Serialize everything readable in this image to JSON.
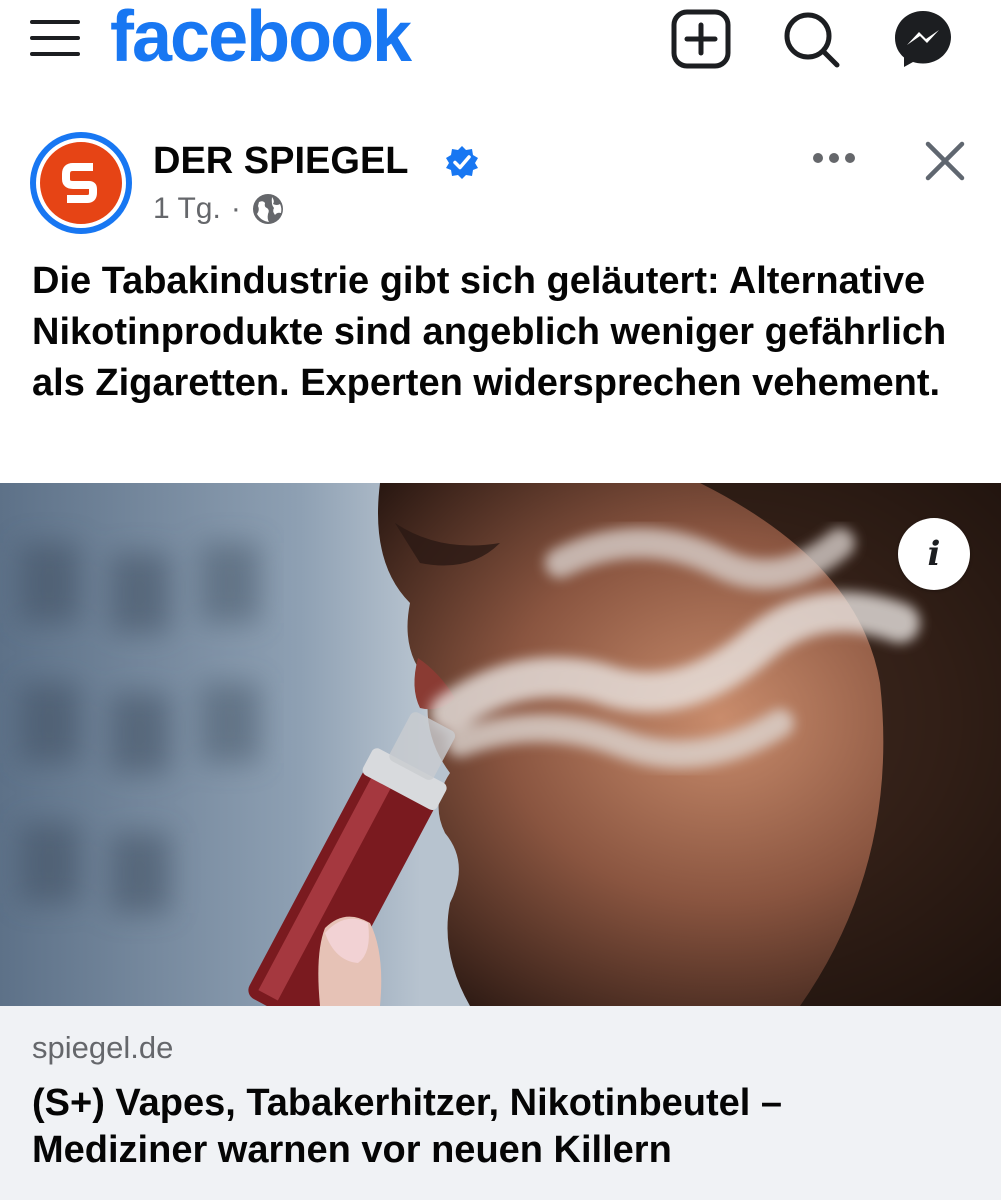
{
  "app": {
    "logo_text": "facebook",
    "brand_color": "#1877f2",
    "top_icons": [
      "menu-icon",
      "add-icon",
      "search-icon",
      "messenger-icon"
    ]
  },
  "post": {
    "page_name": "DER SPIEGEL",
    "verified": true,
    "time": "1 Tg.",
    "separator": "·",
    "audience_icon": "globe-icon",
    "text": "Die Tabakindustrie gibt sich geläutert: Alternative Nikotinprodukte sind angeblich weniger gefährlich als Zigaretten. Experten widersprechen vehement.",
    "image_info_label": "i",
    "link": {
      "domain": "spiegel.de",
      "title": "(S+) Vapes, Tabakerhitzer, Nikotinbeutel – Mediziner warnen vor neuen Killern"
    }
  }
}
